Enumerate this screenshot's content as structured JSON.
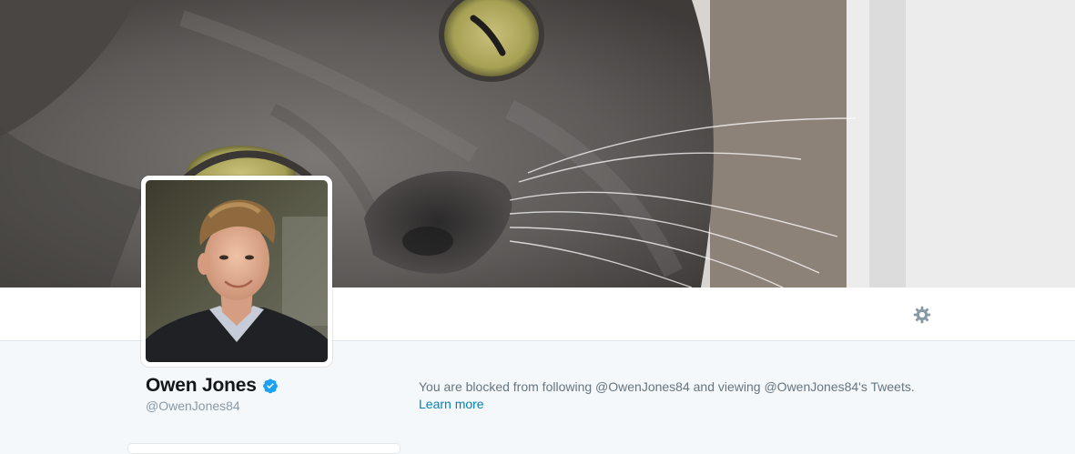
{
  "profile": {
    "name": "Owen Jones",
    "screen_name": "@OwenJones84",
    "verified": true
  },
  "notice": {
    "blocked_text": "You are blocked from following @OwenJones84 and viewing @OwenJones84's Tweets.",
    "learn_more_label": "Learn more"
  },
  "icons": {
    "settings": "gear-icon",
    "verified": "verified-badge-icon"
  },
  "colors": {
    "link": "#0084b4",
    "verified": "#1da1f2",
    "page_background": "#f5f8fa"
  }
}
